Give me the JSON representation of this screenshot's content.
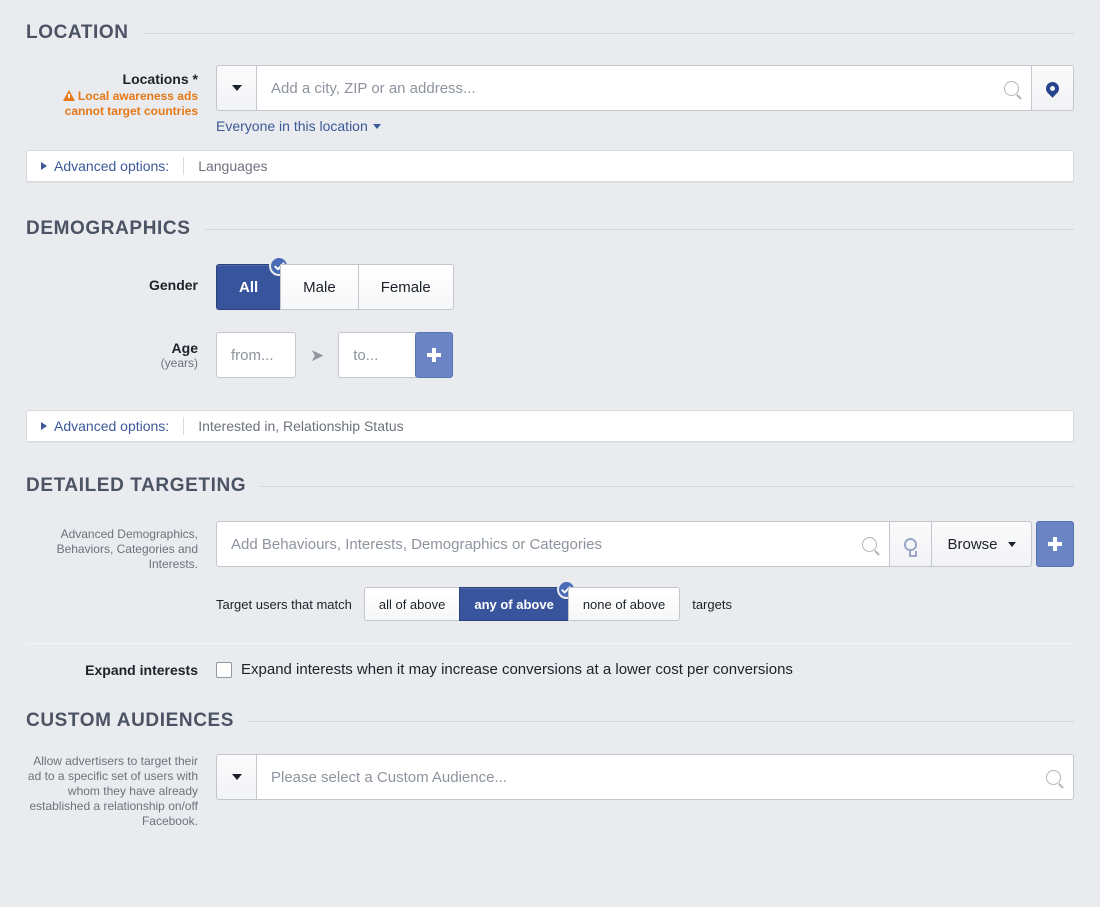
{
  "sections": {
    "location": {
      "title": "LOCATION",
      "label": "Locations *",
      "warning_line1": "Local awareness ads",
      "warning_line2": "cannot target countries",
      "input_placeholder": "Add a city, ZIP or an address...",
      "input_value": "",
      "everyone_link": "Everyone in this location",
      "advanced_label": "Advanced options:",
      "advanced_items": "Languages"
    },
    "demographics": {
      "title": "DEMOGRAPHICS",
      "gender_label": "Gender",
      "gender_options": [
        "All",
        "Male",
        "Female"
      ],
      "gender_selected": "All",
      "age_label": "Age",
      "age_sub": "(years)",
      "age_from_placeholder": "from...",
      "age_from_value": "",
      "age_to_placeholder": "to...",
      "age_to_value": "",
      "add_button_label": "+",
      "advanced_label": "Advanced options:",
      "advanced_items": "Interested in, Relationship Status"
    },
    "detailed_targeting": {
      "title": "DETAILED TARGETING",
      "label_lines": "Advanced Demographics, Behaviors, Categories and Interests.",
      "input_placeholder": "Add Behaviours, Interests, Demographics or Categories",
      "input_value": "",
      "browse_label": "Browse",
      "add_button_label": "+",
      "match_prefix": "Target users that match",
      "match_options": [
        "all of above",
        "any of above",
        "none of above"
      ],
      "match_selected": "any of above",
      "match_suffix": "targets",
      "expand_label": "Expand interests",
      "expand_checkbox_text": "Expand interests when it may increase conversions at a lower cost per conversions",
      "expand_checked": false
    },
    "custom_audiences": {
      "title": "CUSTOM AUDIENCES",
      "description": "Allow advertisers to target their ad to a specific set of users with whom they have already established a relationship on/off Facebook.",
      "input_placeholder": "Please select a Custom Audience...",
      "input_value": ""
    }
  },
  "icons": {
    "search": "search-icon",
    "map_pin": "map-pin-icon",
    "lightbulb": "lightbulb-icon",
    "warning_triangle": "warning-triangle-icon",
    "caret_down": "chevron-down-icon",
    "check": "check-icon",
    "arrow_right": "➔"
  },
  "colors": {
    "page_bg": "#e9ebee",
    "accent_blue": "#3b5998",
    "selected_blue": "#38549c",
    "warning_orange": "#e77817",
    "plus_blue": "#6b84c4",
    "header_gray": "#4b5364"
  }
}
